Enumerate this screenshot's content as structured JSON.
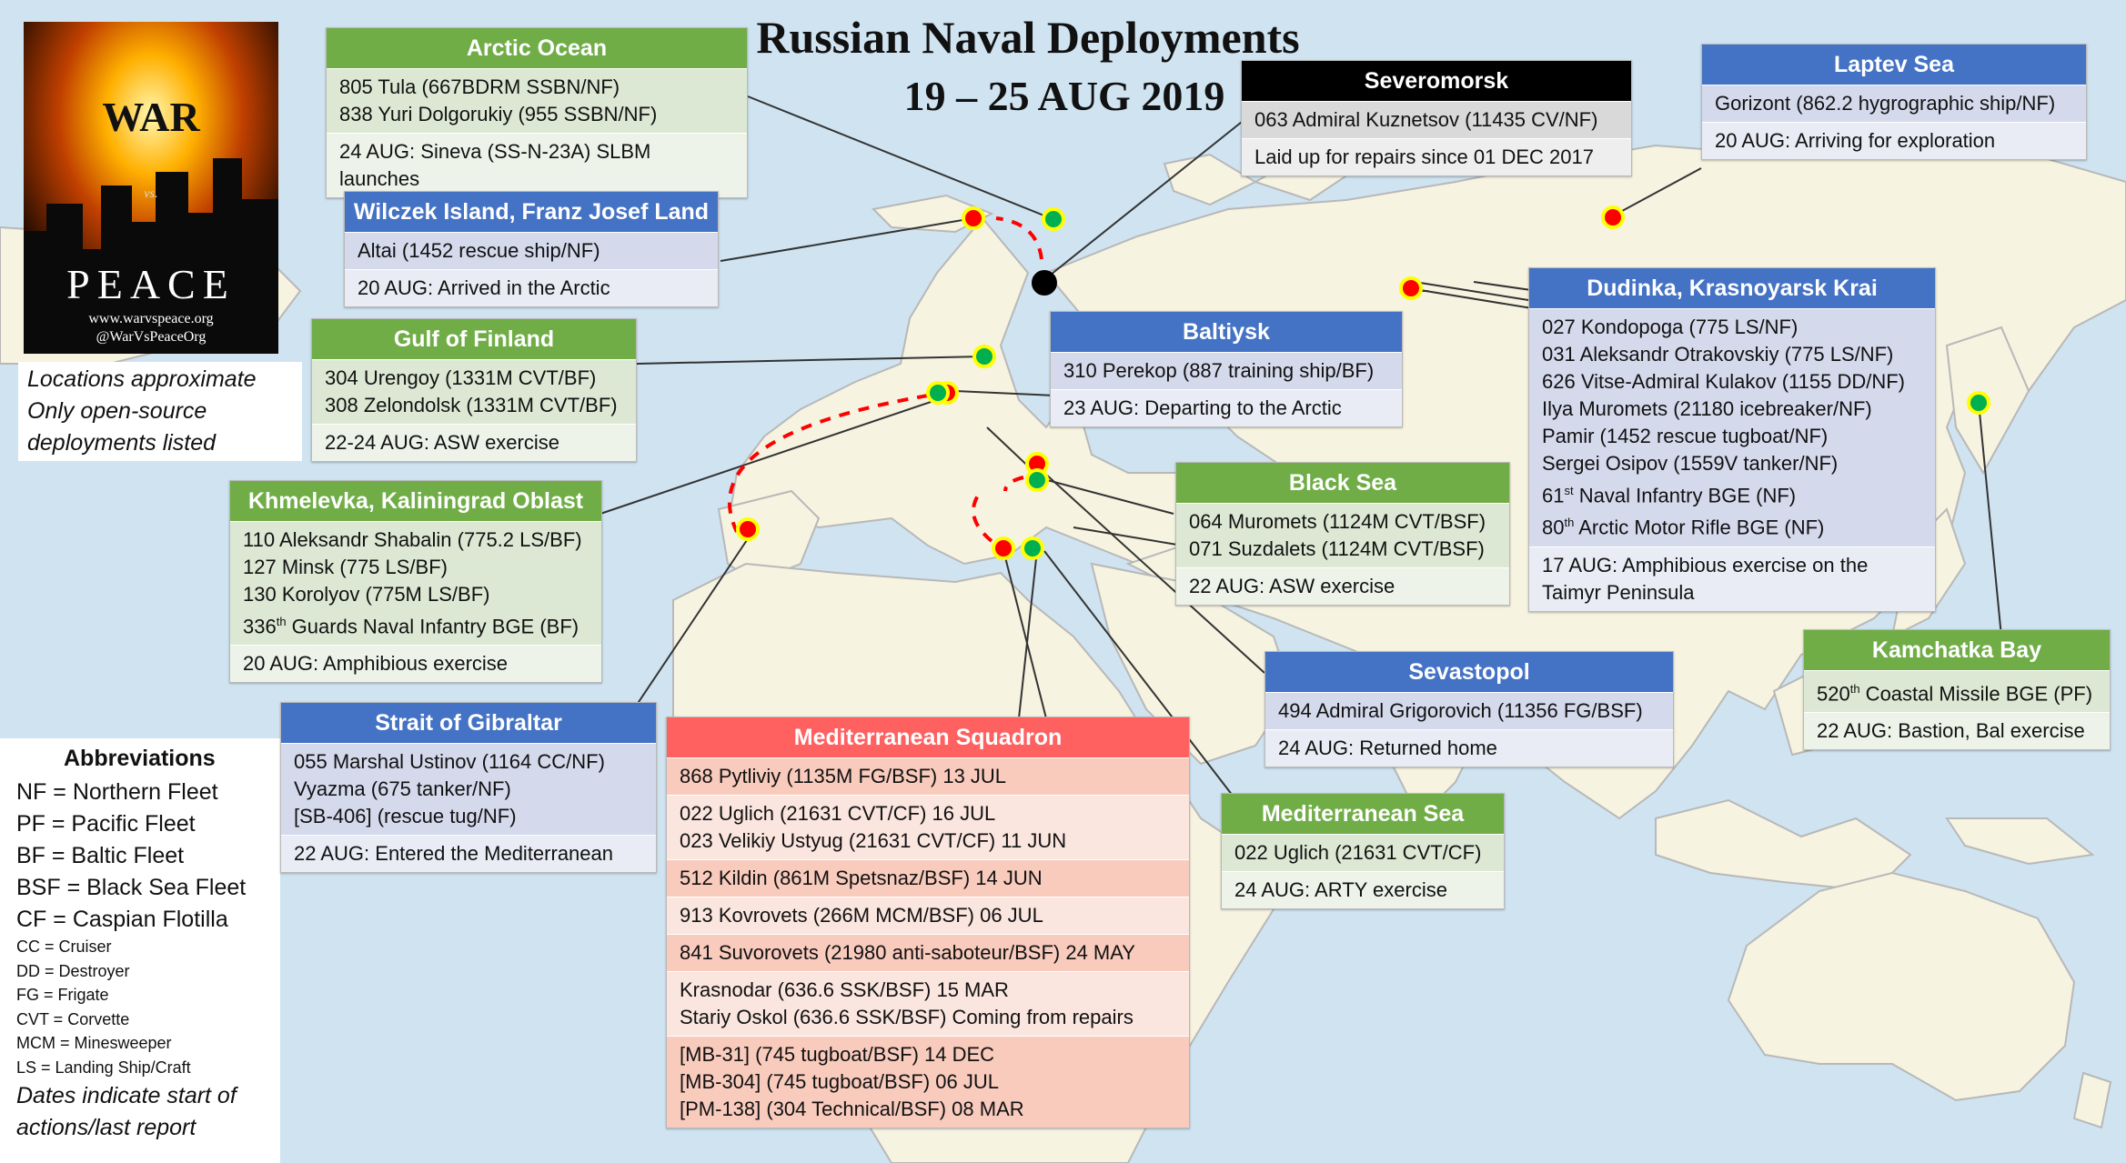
{
  "title": {
    "line1": "Russian Naval Deployments",
    "line2": "19 – 25 AUG 2019"
  },
  "poster": {
    "word1": "WAR",
    "word2": "vs.",
    "word3": "PEACE",
    "url": "www.warvspeace.org",
    "handle": "@WarVsPeaceOrg"
  },
  "note": {
    "line1": "Locations approximate",
    "line2": "Only open-source",
    "line3": "deployments listed"
  },
  "abbreviations": {
    "title": "Abbreviations",
    "major": [
      "NF = Northern Fleet",
      "PF = Pacific Fleet",
      "BF = Baltic Fleet",
      "BSF = Black Sea Fleet",
      "CF = Caspian Flotilla"
    ],
    "minor": [
      "CC = Cruiser",
      "DD = Destroyer",
      "FG = Frigate",
      "CVT = Corvette",
      "MCM = Minesweeper",
      "LS = Landing Ship/Craft"
    ],
    "footer1": "Dates indicate start of",
    "footer2": "actions/last report"
  },
  "colors": {
    "ocean": "#cfe3f1",
    "land": "#f6f3e1",
    "border": "#b8b8b8",
    "green_header": "#70ad47",
    "blue_header": "#4472c4",
    "black_header": "#000000",
    "red_header": "#ff6161",
    "marker_yellow": "#ffff00",
    "marker_red": "#ff0000",
    "marker_green": "#00b050",
    "route_dash": "#ff0000"
  },
  "boxes": {
    "arctic_ocean": {
      "title": "Arctic Ocean",
      "ships": [
        "805 Tula (667BDRM SSBN/NF)",
        "838 Yuri Dolgorukiy (955 SSBN/NF)"
      ],
      "note": "24 AUG: Sineva (SS-N-23A) SLBM launches"
    },
    "severomorsk": {
      "title": "Severomorsk",
      "ships": [
        "063 Admiral Kuznetsov (11435 CV/NF)"
      ],
      "note": "Laid up for repairs since 01 DEC 2017"
    },
    "laptev": {
      "title": "Laptev Sea",
      "ships": [
        "Gorizont (862.2 hygrographic ship/NF)"
      ],
      "note": "20 AUG: Arriving for exploration"
    },
    "wilczek": {
      "title": "Wilczek Island, Franz Josef Land",
      "ships": [
        "Altai (1452 rescue ship/NF)"
      ],
      "note": "20 AUG: Arrived in the Arctic"
    },
    "finland": {
      "title": "Gulf of Finland",
      "ships": [
        "304 Urengoy (1331M CVT/BF)",
        "308 Zelondolsk (1331M CVT/BF)"
      ],
      "note": "22-24 AUG: ASW exercise"
    },
    "baltiysk": {
      "title": "Baltiysk",
      "ships": [
        "310 Perekop (887 training ship/BF)"
      ],
      "note": "23 AUG: Departing to the Arctic"
    },
    "dudinka": {
      "title": "Dudinka, Krasnoyarsk Krai",
      "ships": [
        "027 Kondopoga (775 LS/NF)",
        "031 Aleksandr Otrakovskiy (775 LS/NF)",
        "626 Vitse-Admiral Kulakov (1155 DD/NF)",
        "Ilya Muromets (21180 icebreaker/NF)",
        "Pamir (1452 rescue tugboat/NF)",
        "Sergei Osipov (1559V tanker/NF)"
      ],
      "unit1_pre": "61",
      "unit1_sup": "st",
      "unit1_post": " Naval Infantry BGE (NF)",
      "unit2_pre": "80",
      "unit2_sup": "th",
      "unit2_post": " Arctic Motor Rifle BGE (NF)",
      "note1": "17 AUG: Amphibious exercise on the",
      "note2": "Taimyr Peninsula"
    },
    "khmelevka": {
      "title": "Khmelevka, Kaliningrad Oblast",
      "ships": [
        "110 Aleksandr Shabalin (775.2 LS/BF)",
        "127 Minsk (775 LS/BF)",
        "130 Korolyov (775M LS/BF)"
      ],
      "unit_pre": "336",
      "unit_sup": "th",
      "unit_post": " Guards Naval Infantry BGE (BF)",
      "note": "20 AUG: Amphibious exercise"
    },
    "black_sea": {
      "title": "Black Sea",
      "ships": [
        "064 Muromets (1124M CVT/BSF)",
        "071 Suzdalets (1124M CVT/BSF)"
      ],
      "note": "22 AUG: ASW exercise"
    },
    "kamchatka": {
      "title": "Kamchatka Bay",
      "unit_pre": "520",
      "unit_sup": "th",
      "unit_post": " Coastal Missile BGE (PF)",
      "note": "22 AUG: Bastion, Bal exercise"
    },
    "sevastopol": {
      "title": "Sevastopol",
      "ships": [
        "494 Admiral Grigorovich (11356 FG/BSF)"
      ],
      "note": "24 AUG: Returned home"
    },
    "gibraltar": {
      "title": "Strait of Gibraltar",
      "ships": [
        "055 Marshal Ustinov (1164 CC/NF)",
        "Vyazma (675 tanker/NF)",
        "[SB-406] (rescue tug/NF)"
      ],
      "note": "22 AUG: Entered the Mediterranean"
    },
    "med_sea": {
      "title": "Mediterranean Sea",
      "ships": [
        "022 Uglich (21631 CVT/CF)"
      ],
      "note": "24 AUG: ARTY exercise"
    },
    "med_squadron": {
      "title": "Mediterranean Squadron",
      "rows": [
        [
          "868 Pytliviy (1135M FG/BSF) 13 JUL"
        ],
        [
          "022 Uglich (21631 CVT/CF) 16 JUL",
          "023 Velikiy Ustyug (21631 CVT/CF) 11 JUN"
        ],
        [
          "512 Kildin (861M Spetsnaz/BSF) 14 JUN"
        ],
        [
          "913 Kovrovets (266M MCM/BSF) 06 JUL"
        ],
        [
          "841 Suvorovets (21980 anti-saboteur/BSF) 24 MAY"
        ],
        [
          "Krasnodar (636.6 SSK/BSF) 15 MAR",
          "Stariy Oskol (636.6 SSK/BSF) Coming from repairs"
        ],
        [
          "[MB-31] (745 tugboat/BSF) 14 DEC",
          "[MB-304] (745 tugboat/BSF) 06 JUL",
          "[PM-138] (304 Technical/BSF) 08 MAR"
        ]
      ]
    }
  }
}
